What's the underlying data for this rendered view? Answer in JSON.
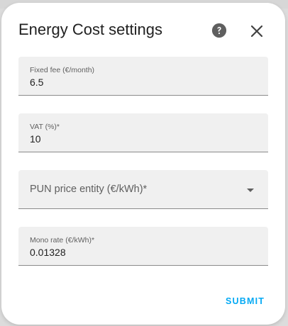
{
  "dialog": {
    "title": "Energy Cost settings",
    "help_icon": "help-circle-icon",
    "close_icon": "close-icon"
  },
  "fields": {
    "fixed_fee": {
      "label": "Fixed fee (€/month)",
      "value": "6.5"
    },
    "vat": {
      "label": "VAT (%)*",
      "value": "10"
    },
    "pun_entity": {
      "placeholder": "PUN price entity (€/kWh)*",
      "icon": "chevron-down-icon"
    },
    "mono_rate": {
      "label": "Mono rate (€/kWh)*",
      "value": "0.01328"
    }
  },
  "actions": {
    "submit_label": "SUBMIT"
  },
  "colors": {
    "accent": "#03a9f4",
    "field_bg": "#f0f0f0",
    "text": "#212121",
    "muted": "#5f5f5f"
  }
}
